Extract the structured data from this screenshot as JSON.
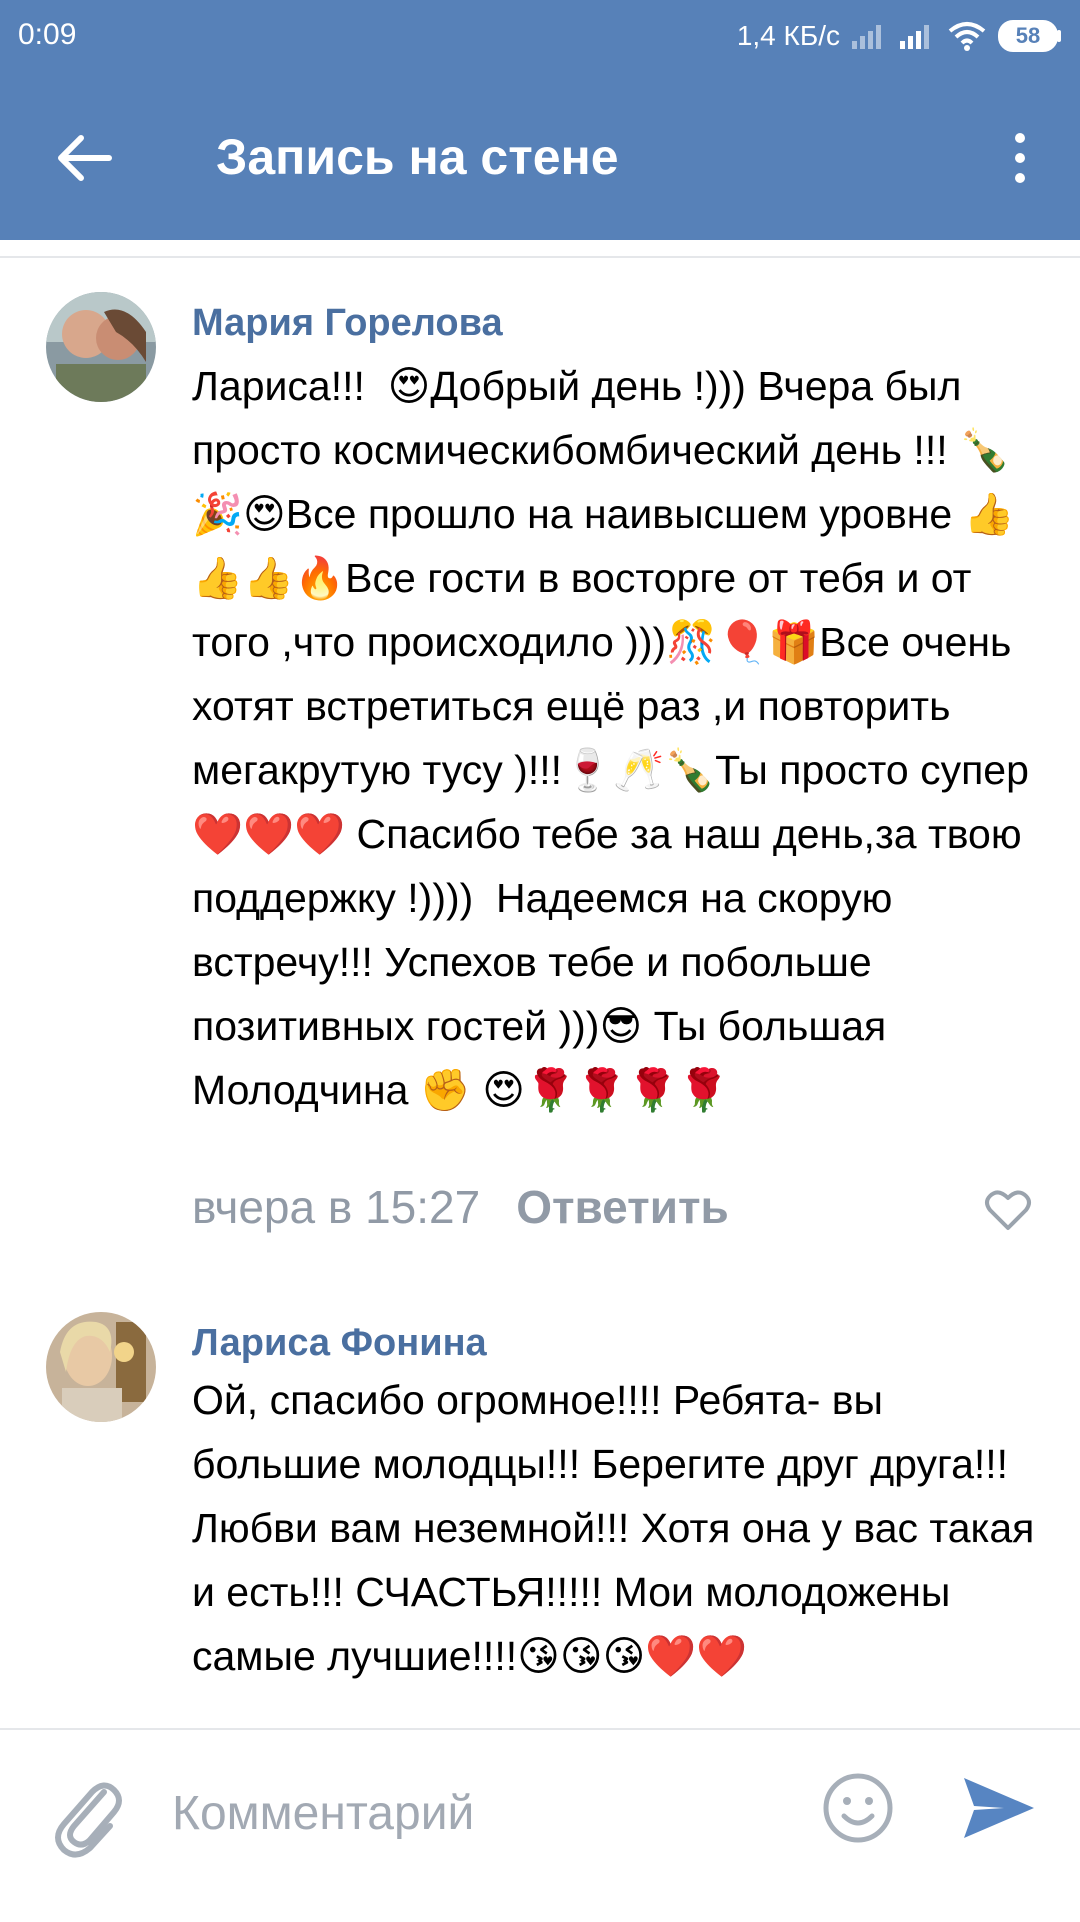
{
  "status_bar": {
    "time": "0:09",
    "network_speed": "1,4 КБ/с",
    "battery": "58"
  },
  "header": {
    "title": "Запись на стене"
  },
  "comments": [
    {
      "author": "Мария Горелова",
      "text": "Лариса!!!  😍Добрый день !))) Вчера был просто космическибомбический день !!! 🍾🎉😍Все прошло на наивысшем уровне 👍👍👍🔥Все гости в восторге от тебя и от того ,что происходило )))🎊🎈🎁Все очень хотят встретиться ещё раз ,и повторить мегакрутую тусу )!!!🍷🥂🍾Ты просто супер ❤️❤️❤️ Спасибо тебе за наш день,за твою поддержку !))))  Надеемся на скорую встречу!!! Успехов тебе и побольше позитивных гостей )))😎 Ты большая Молодчина ✊ 😍🌹🌹🌹🌹",
      "time": "вчера в 15:27",
      "reply": "Ответить"
    },
    {
      "author": "Лариса Фонина",
      "text": "Ой, спасибо огромное!!!! Ребята- вы большие молодцы!!! Берегите друг друга!!! Любви вам неземной!!! Хотя она у вас такая и есть!!! СЧАСТЬЯ!!!!! Мои молодожены самые лучшие!!!!😘😘😘❤️❤️"
    }
  ],
  "input": {
    "placeholder": "Комментарий"
  }
}
